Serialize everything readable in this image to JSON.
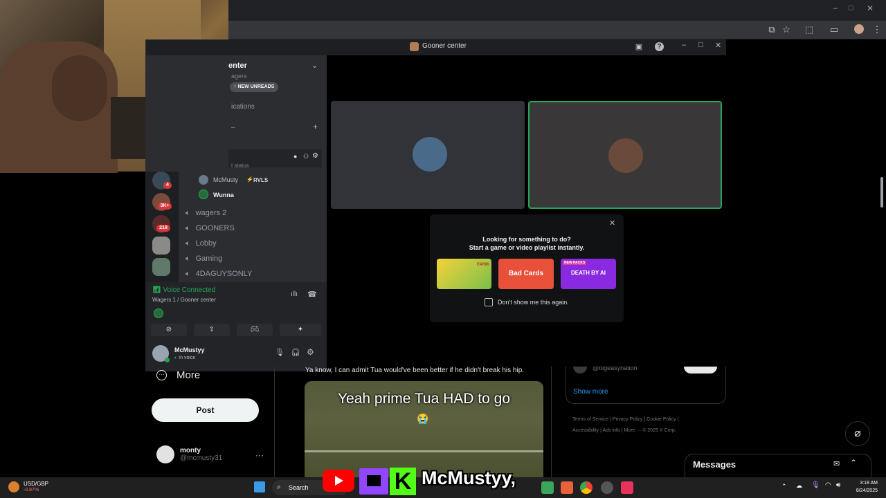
{
  "window": {
    "title": "Gooner center"
  },
  "browser": {
    "colors": {
      "chrome": "#202124"
    }
  },
  "sidebar": {
    "header_partial": "enter",
    "new_unreads": "NEW UNREADS",
    "item_partial_1": "agers",
    "item_partial_2": "ications",
    "status_partial": "t status",
    "voice_users": [
      {
        "name": "McMusty",
        "tag": "RVLS"
      },
      {
        "name": "Wunna"
      }
    ],
    "channels": [
      "wagers 2",
      "GOONERS",
      "Lobby",
      "Gaming",
      "4DAGUYSONLY"
    ],
    "server_badges": [
      "4",
      "3K+",
      "218"
    ]
  },
  "voice": {
    "status": "Voice Connected",
    "location": "Wagers 1 / Gooner center"
  },
  "user_panel": {
    "name": "McMustyy",
    "status": "In voice"
  },
  "activity_popup": {
    "line1": "Looking for something to do?",
    "line2": "Start a game or video playlist instantly.",
    "games": [
      {
        "label": "FARM"
      },
      {
        "label": "Bad Cards"
      },
      {
        "label": "DEATH BY AI",
        "badge": "NEW PACKS"
      }
    ],
    "checkbox_label": "Don't show me this again."
  },
  "twitter": {
    "more_label": "More",
    "post_label": "Post",
    "account_name": "monty",
    "account_handle": "@mcmusty31",
    "tweet_text": "Ya know, I can admit Tua would've been better if he didn't break his hip.",
    "video_caption": "Yeah prime Tua HAD to go",
    "show_more": "Show more",
    "footer_links": [
      "Terms of Service",
      "Privacy Policy",
      "Cookie Policy",
      "Accessibility",
      "Ads info",
      "More ···",
      "© 2025 X Corp."
    ],
    "partial_handle": "@bigeasynation",
    "messages_label": "Messages"
  },
  "taskbar": {
    "ticker_symbol": "USD/GBP",
    "ticker_change": "-0.87%",
    "search_label": "Search",
    "time": "3:18 AM",
    "date": "8/24/2025"
  },
  "overlay": {
    "streamer_name": "McMustyy,"
  }
}
